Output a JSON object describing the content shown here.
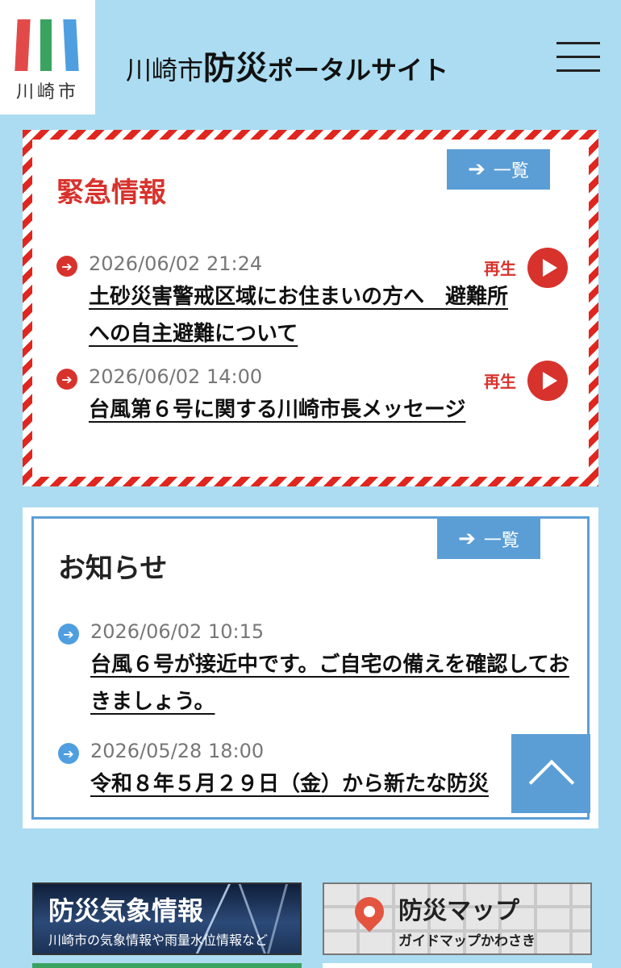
{
  "header": {
    "logo_text": "川崎市",
    "title_part1": "川崎市",
    "title_part2": "防災",
    "title_part3": "ポータルサイト"
  },
  "emergency": {
    "title": "緊急情報",
    "list_button": "一覧",
    "play_label": "再生",
    "items": [
      {
        "date": "2026/06/02 21:24",
        "text": "土砂災害警戒区域にお住まいの方へ　避難所への自主避難について"
      },
      {
        "date": "2026/06/02 14:00",
        "text": "台風第６号に関する川崎市長メッセージ"
      }
    ]
  },
  "notice": {
    "title": "お知らせ",
    "list_button": "一覧",
    "items": [
      {
        "date": "2026/06/02 10:15",
        "text": "台風６号が接近中です。ご自宅の備えを確認しておきましょう。"
      },
      {
        "date": "2026/05/28 18:00",
        "text": "令和８年５月２９日（金）から新たな防災"
      }
    ]
  },
  "banners": {
    "weather_title": "防災気象情報",
    "weather_sub": "川崎市の気象情報や雨量水位情報など",
    "map_title": "防災マップ",
    "map_sub": "ガイドマップかわさき"
  },
  "colors": {
    "background": "#abdcf1",
    "emergency_red": "#d8322c",
    "accent_blue": "#5b9ed6"
  }
}
